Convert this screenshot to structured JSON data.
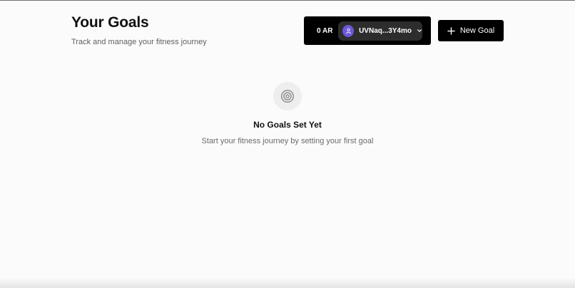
{
  "header": {
    "title": "Your Goals",
    "subtitle": "Track and manage your fitness journey"
  },
  "wallet": {
    "balance": "0 AR",
    "address": "UVNaq...3Y4mo",
    "avatar_color": "#6b58d8",
    "avatar_icon": "user-icon",
    "dropdown_icon": "chevron-down-icon"
  },
  "actions": {
    "new_goal_label": "New Goal",
    "new_goal_icon": "plus-icon"
  },
  "empty_state": {
    "icon": "target-icon",
    "title": "No Goals Set Yet",
    "message": "Start your fitness journey by setting your first goal"
  },
  "colors": {
    "background": "#fbfbfb",
    "button": "#000000",
    "account_pill": "#2d2d2d",
    "muted_text": "#6b6b6b"
  }
}
